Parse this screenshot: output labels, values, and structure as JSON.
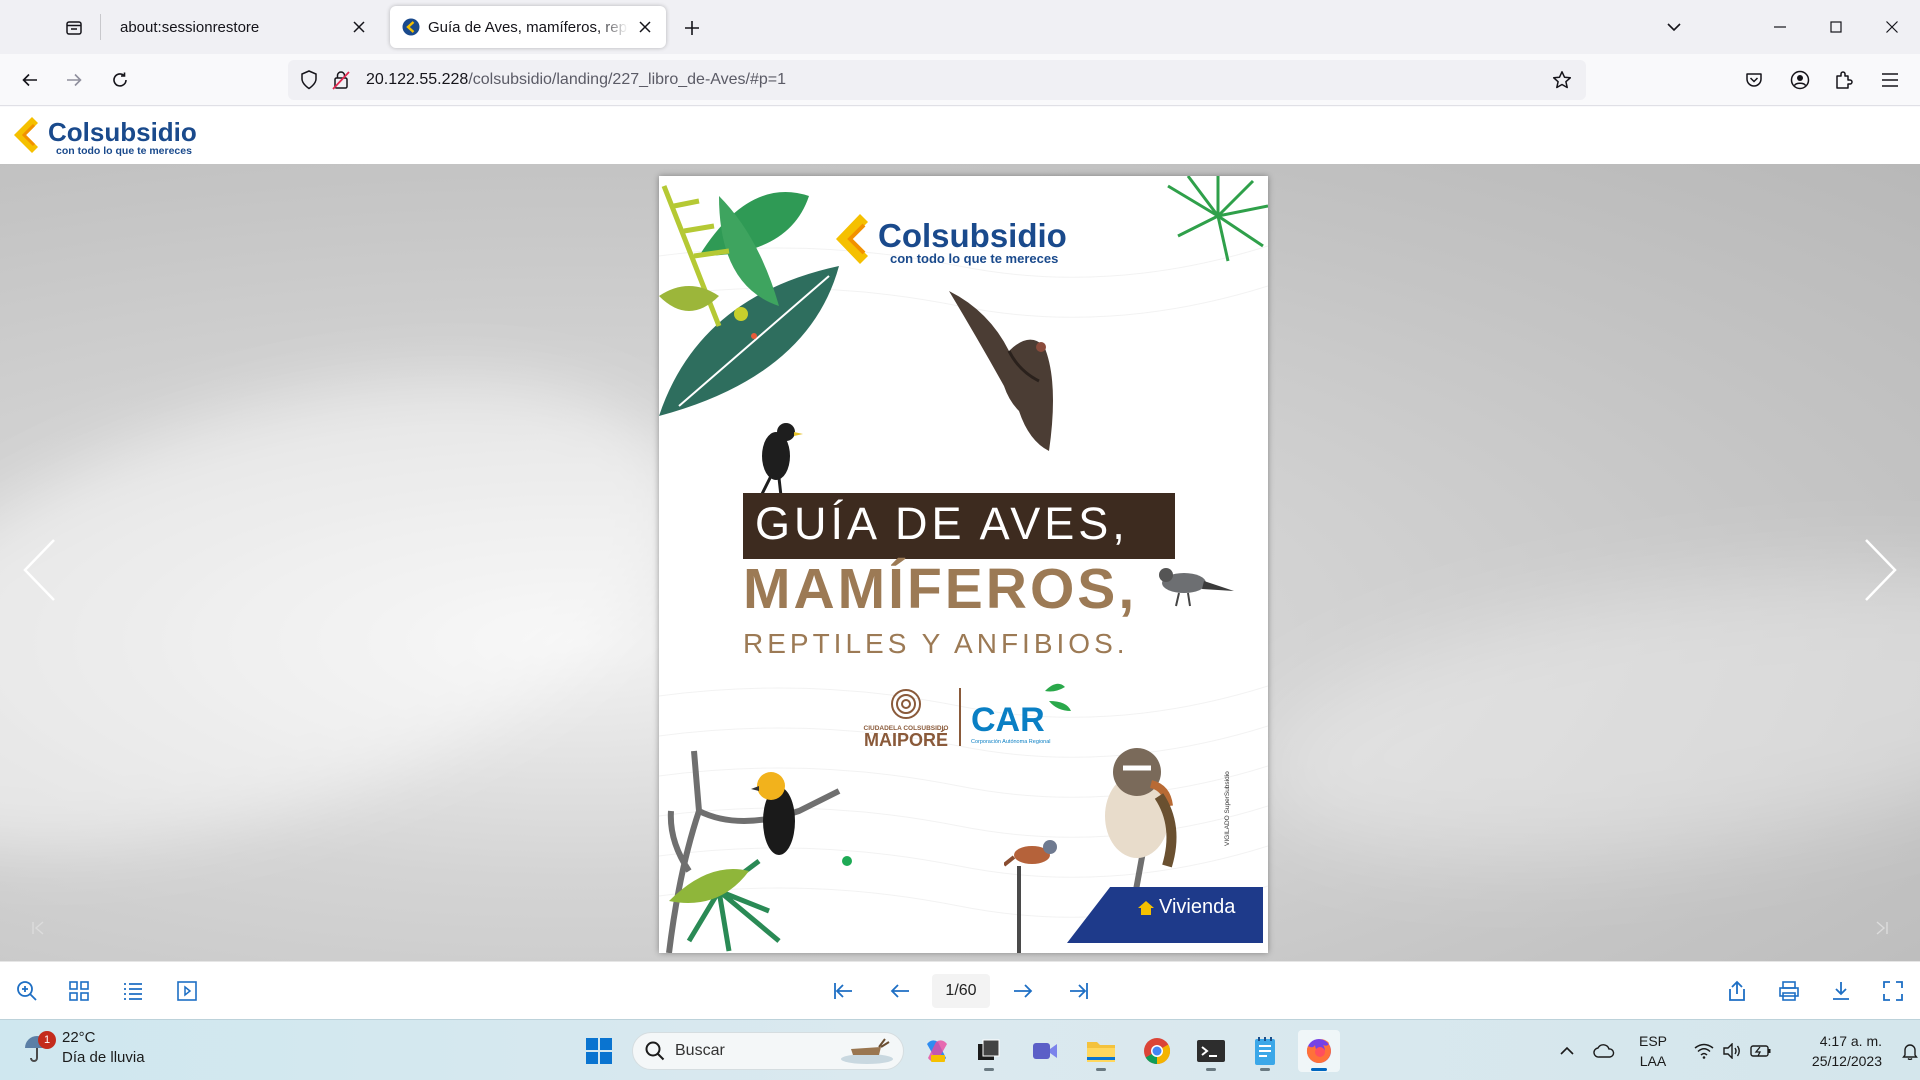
{
  "browser": {
    "tabs": [
      {
        "title": "about:sessionrestore",
        "active": false
      },
      {
        "title": "Guía de Aves, mamíferos, reptil",
        "active": true
      }
    ],
    "url": {
      "host": "20.122.55.228",
      "path": "/colsubsidio/landing/227_libro_de-Aves/#p=1"
    }
  },
  "site": {
    "logo_name": "Colsubsidio",
    "logo_tagline": "con todo lo que te mereces"
  },
  "cover": {
    "logo_name": "Colsubsidio",
    "logo_tagline": "con todo lo que te mereces",
    "title_line1": "GUÍA DE AVES,",
    "title_line2": "MAMÍFEROS,",
    "title_line3": "REPTILES Y ANFIBIOS.",
    "partner1_small": "CIUDADELA COLSUBSIDIO",
    "partner1": "MAIPORÉ",
    "partner2": "CAR",
    "partner2_small": "Corporación Autónoma Regional",
    "vertical_text": "VIGILADO SuperSubsidio",
    "corner_label": "Vivienda"
  },
  "viewer": {
    "page_counter": "1/60"
  },
  "taskbar": {
    "weather_temp": "22°C",
    "weather_desc": "Día de lluvia",
    "weather_badge": "1",
    "search_label": "Buscar",
    "lang_line1": "ESP",
    "lang_line2": "LAA",
    "time": "4:17 a. m.",
    "date": "25/12/2023"
  },
  "colors": {
    "brand_blue": "#1a4a8c",
    "brand_yellow": "#f5c000",
    "title_dark": "#3d2b1f",
    "title_brown": "#9c7a55",
    "car_blue": "#0a7fc4"
  }
}
